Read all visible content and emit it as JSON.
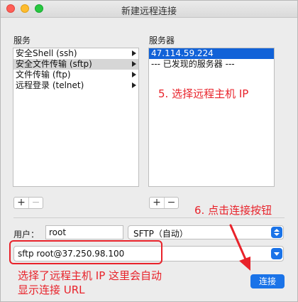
{
  "window": {
    "title": "新建远程连接"
  },
  "services": {
    "label": "服务",
    "items": [
      {
        "label": "安全Shell (ssh)",
        "selected": false
      },
      {
        "label": "安全文件传输 (sftp)",
        "selected": true
      },
      {
        "label": "文件传输 (ftp)",
        "selected": false
      },
      {
        "label": "远程登录 (telnet)",
        "selected": false
      }
    ],
    "add_label": "+",
    "remove_label": "−"
  },
  "servers": {
    "label": "服务器",
    "items": [
      {
        "label": "47.114.59.224",
        "selected": true
      },
      {
        "label": "--- 已发现的服务器 ---",
        "selected": false
      }
    ],
    "add_label": "+",
    "remove_label": "−"
  },
  "form": {
    "user_label": "用户：",
    "user_value": "root",
    "protocol_value": "SFTP（自动）",
    "url_value": "sftp root@37.250.98.100",
    "connect_label": "连接"
  },
  "annotations": {
    "select_ip": "5. 选择远程主机 IP",
    "click_connect": "6. 点击连接按钮",
    "url_line1": "选择了远程主机 IP 这里会自动",
    "url_line2": "显示连接 URL"
  },
  "colors": {
    "accent": "#1a73e8",
    "selection": "#1162d8",
    "annotation": "#e8222a"
  }
}
